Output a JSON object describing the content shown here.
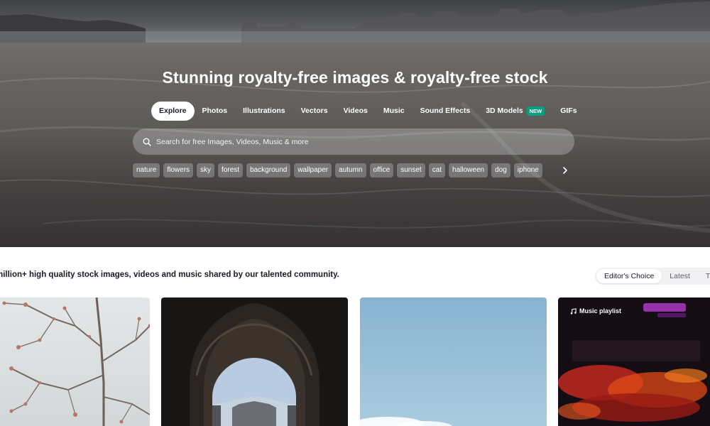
{
  "hero": {
    "title": "Stunning royalty-free images & royalty-free stock",
    "tabs": [
      {
        "label": "Explore",
        "active": true
      },
      {
        "label": "Photos"
      },
      {
        "label": "Illustrations"
      },
      {
        "label": "Vectors"
      },
      {
        "label": "Videos"
      },
      {
        "label": "Music"
      },
      {
        "label": "Sound Effects"
      },
      {
        "label": "3D Models",
        "badge": "NEW"
      },
      {
        "label": "GIFs"
      }
    ],
    "search": {
      "placeholder": "Search for free Images, Videos, Music & more",
      "icon": "search-icon"
    },
    "chips": [
      "nature",
      "flowers",
      "sky",
      "forest",
      "background",
      "wallpaper",
      "autumn",
      "office",
      "sunset",
      "cat",
      "halloween",
      "dog",
      "iphone"
    ],
    "chips_next_icon": "chevron-right-icon"
  },
  "main": {
    "tagline": "million+ high quality stock images, videos and music shared by our talented community.",
    "sort_options": [
      {
        "label": "Editor's Choice",
        "active": true
      },
      {
        "label": "Latest"
      },
      {
        "label": "T"
      }
    ],
    "cards": [
      {
        "type": "image",
        "subject": "bare branches with buds against pale sky"
      },
      {
        "type": "image",
        "subject": "dark stone archway framing a domed building"
      },
      {
        "type": "image",
        "subject": "light blue sky with clouds"
      },
      {
        "type": "music",
        "label": "Music playlist",
        "icon": "music-note-icon"
      }
    ]
  },
  "colors": {
    "accent_badge": "#05a081",
    "text_dark": "#191b26",
    "sort_bg": "#f1f1f3"
  }
}
